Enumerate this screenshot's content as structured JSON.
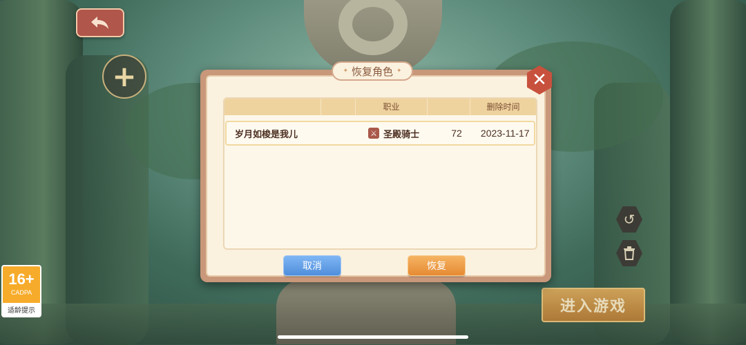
{
  "dialog": {
    "title": "恢复角色",
    "table": {
      "headers": [
        "",
        "职业",
        "",
        "删除时间"
      ],
      "rows": [
        {
          "name": "岁月如梭是我儿",
          "job": "圣殿骑士",
          "level": "72",
          "deleted": "2023-11-17"
        }
      ]
    },
    "cancel_label": "取消",
    "restore_label": "恢复"
  },
  "enter_game_label": "进入游戏",
  "age_rating": {
    "age": "16+",
    "org": "CADPA",
    "tip": "适龄提示"
  },
  "icons": {
    "back": "back-arrow-icon",
    "add": "plus-icon",
    "close": "close-icon",
    "restore": "rotate-icon",
    "delete": "trash-icon",
    "job": "sword-icon"
  }
}
